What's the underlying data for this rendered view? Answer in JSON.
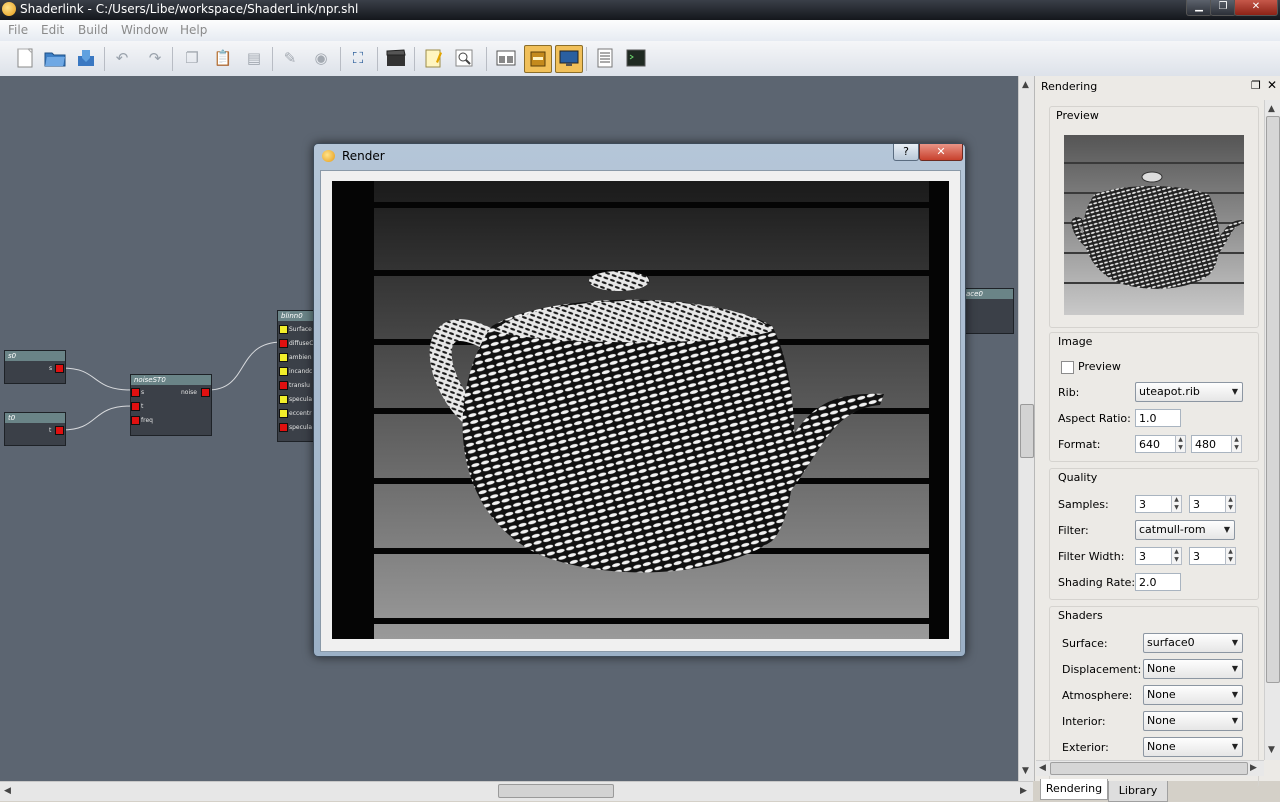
{
  "window": {
    "title": "Shaderlink - C:/Users/Libe/workspace/ShaderLink/npr.shl",
    "minimize": "▁",
    "maximize": "❐",
    "close": "✕"
  },
  "menu": [
    "File",
    "Edit",
    "Build",
    "Window",
    "Help"
  ],
  "toolbar_icons": [
    "new-file-icon",
    "open-folder-icon",
    "save-icon",
    "undo-icon",
    "redo-icon",
    "copy-icon",
    "paste-icon",
    "print-icon",
    "brush-icon",
    "sphere-icon",
    "fit-view-icon",
    "clapper-icon",
    "notepad-icon",
    "zoom-icon",
    "layout-icon",
    "dock-icon",
    "monitor-icon",
    "list-icon",
    "terminal-icon"
  ],
  "nodes": {
    "s0": {
      "title": "s0",
      "port": "s"
    },
    "t0": {
      "title": "t0",
      "port": "t"
    },
    "noise": {
      "title": "noiseST0",
      "inputs": [
        "s",
        "t",
        "freq"
      ],
      "output": "noise"
    },
    "blinn": {
      "title": "blinn0",
      "inputs": [
        "Surface",
        "diffuseC",
        "ambien",
        "incandc",
        "translu",
        "specula",
        "eccentr",
        "specula"
      ]
    },
    "surface": {
      "title": "ace0"
    }
  },
  "render_dialog": {
    "title": "Render",
    "help": "?",
    "close": "✕"
  },
  "dock": {
    "title": "Rendering",
    "preview_group": "Preview",
    "image_group": {
      "title": "Image",
      "preview_checkbox": "Preview",
      "rib_label": "Rib:",
      "rib_value": "uteapot.rib",
      "aspect_label": "Aspect Ratio:",
      "aspect_value": "1.0",
      "format_label": "Format:",
      "format_width": "640",
      "format_height": "480"
    },
    "quality_group": {
      "title": "Quality",
      "samples_label": "Samples:",
      "samples_x": "3",
      "samples_y": "3",
      "filter_label": "Filter:",
      "filter_value": "catmull-rom",
      "filter_width_label": "Filter Width:",
      "filter_width_x": "3",
      "filter_width_y": "3",
      "shading_rate_label": "Shading Rate:",
      "shading_rate_value": "2.0"
    },
    "shaders_group": {
      "title": "Shaders",
      "surface_label": "Surface:",
      "surface_value": "surface0",
      "displacement_label": "Displacement:",
      "displacement_value": "None",
      "atmosphere_label": "Atmosphere:",
      "atmosphere_value": "None",
      "interior_label": "Interior:",
      "interior_value": "None",
      "exterior_label": "Exterior:",
      "exterior_value": "None"
    },
    "tabs": [
      "Rendering",
      "Library"
    ],
    "active_tab": "Rendering"
  },
  "colors": {
    "canvas": "#5c6571",
    "node_header": "#6a8487",
    "port_red": "#e01010",
    "port_yellow": "#f2ee2a"
  }
}
